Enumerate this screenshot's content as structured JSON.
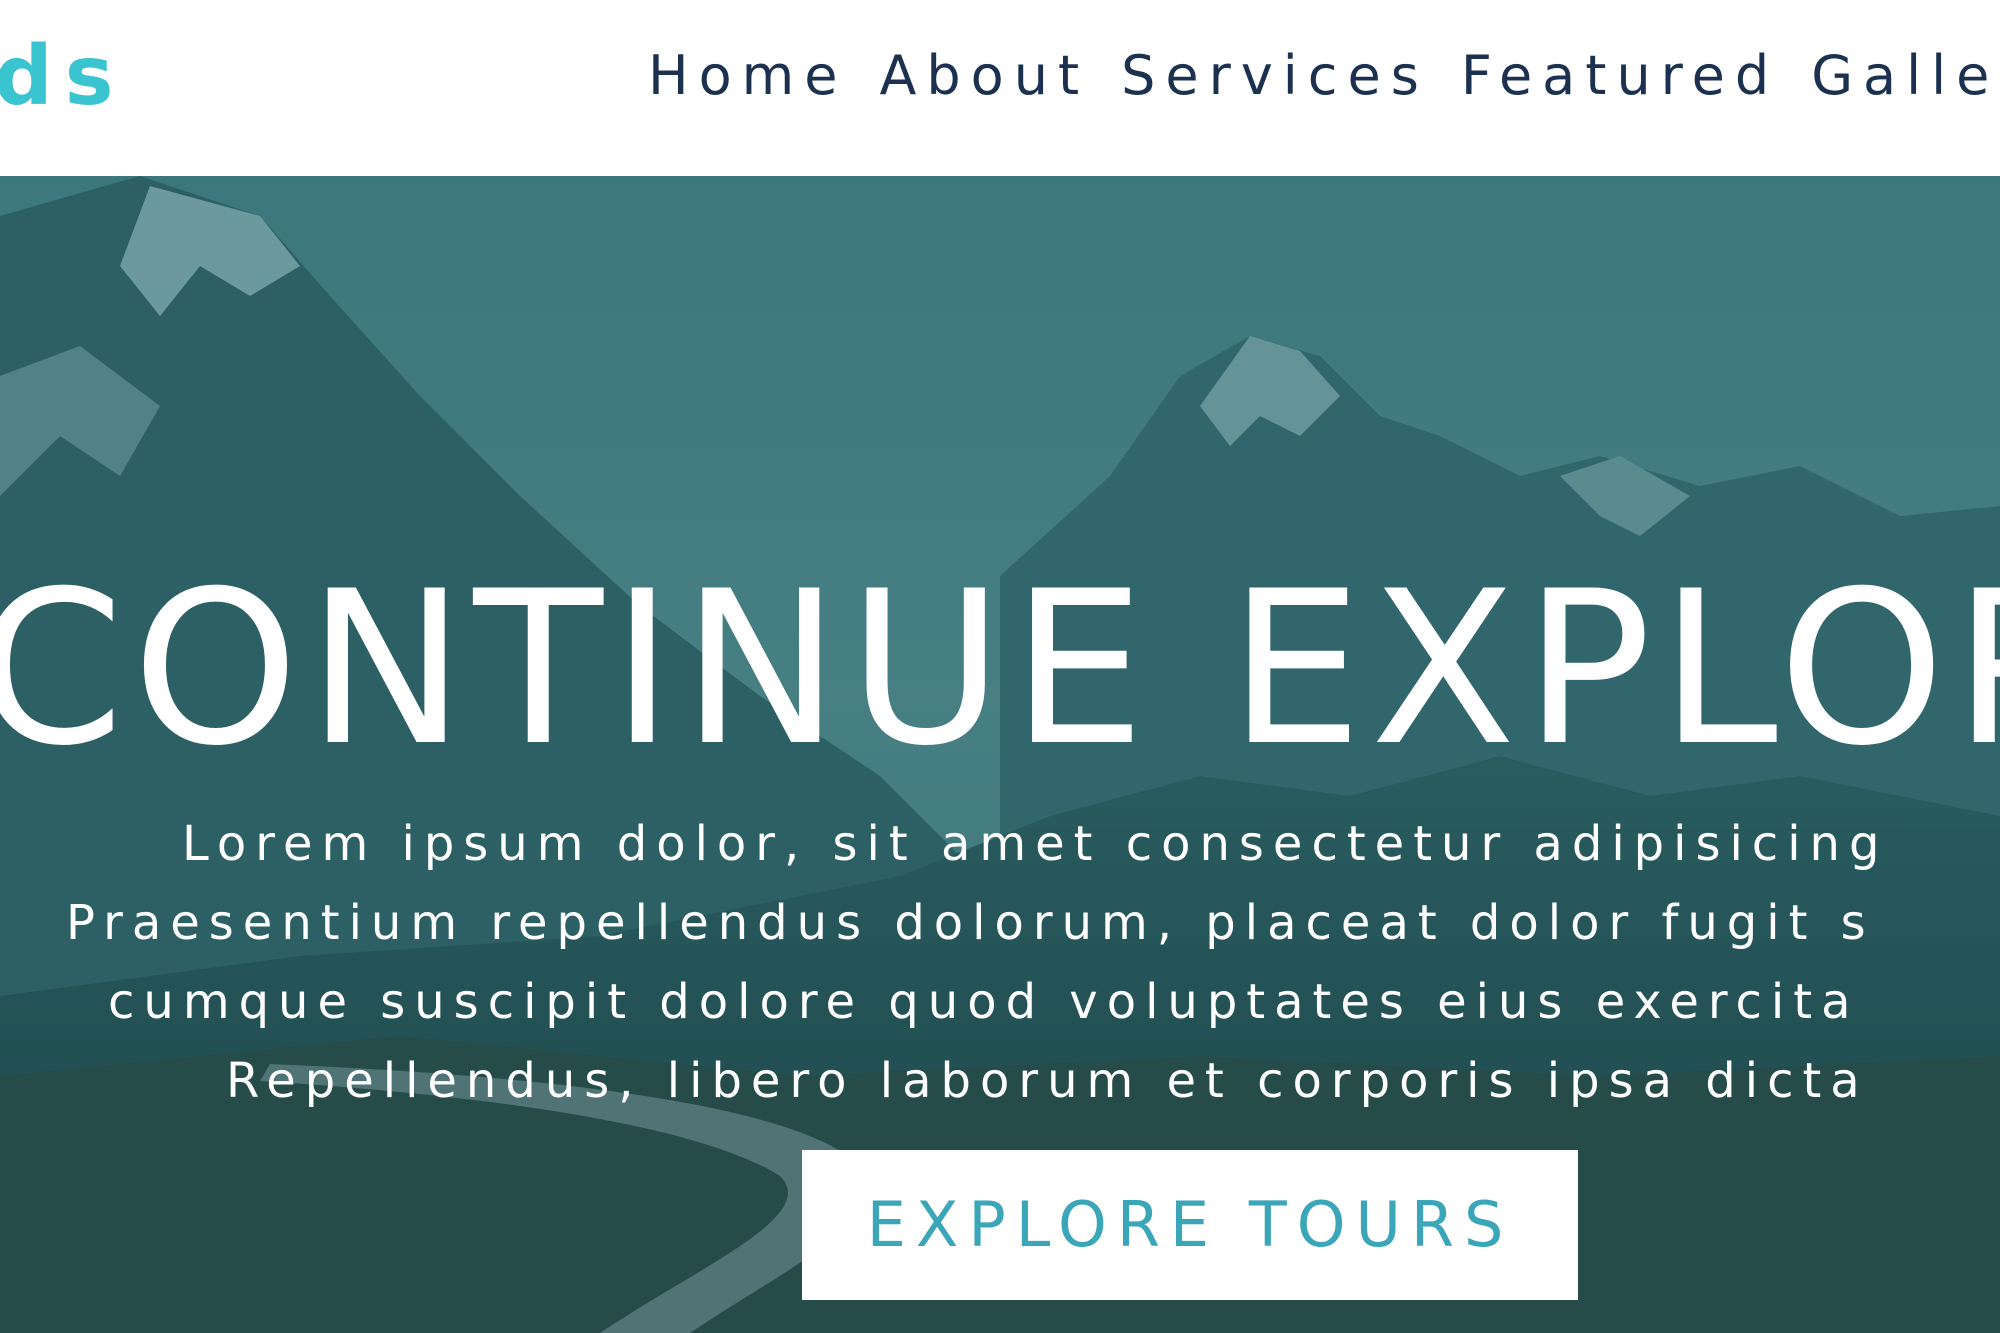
{
  "navbar": {
    "brand": "ds",
    "links": [
      "Home",
      "About",
      "Services",
      "Featured",
      "Galle"
    ]
  },
  "hero": {
    "title": "CONTINUE EXPLOR",
    "paragraph_lines": [
      "Lorem ipsum dolor, sit amet consectetur adipisicing",
      "Praesentium repellendus dolorum, placeat dolor fugit s",
      "cumque suscipit dolore quod voluptates eius exercita",
      "Repellendus, libero laborum et corporis ipsa dicta"
    ],
    "button_label": "EXPLORE TOURS"
  },
  "colors": {
    "brand": "#3ac4cf",
    "nav_text": "#1c3150",
    "button_text": "#3aa6b8",
    "overlay": "#206268"
  },
  "icons": []
}
